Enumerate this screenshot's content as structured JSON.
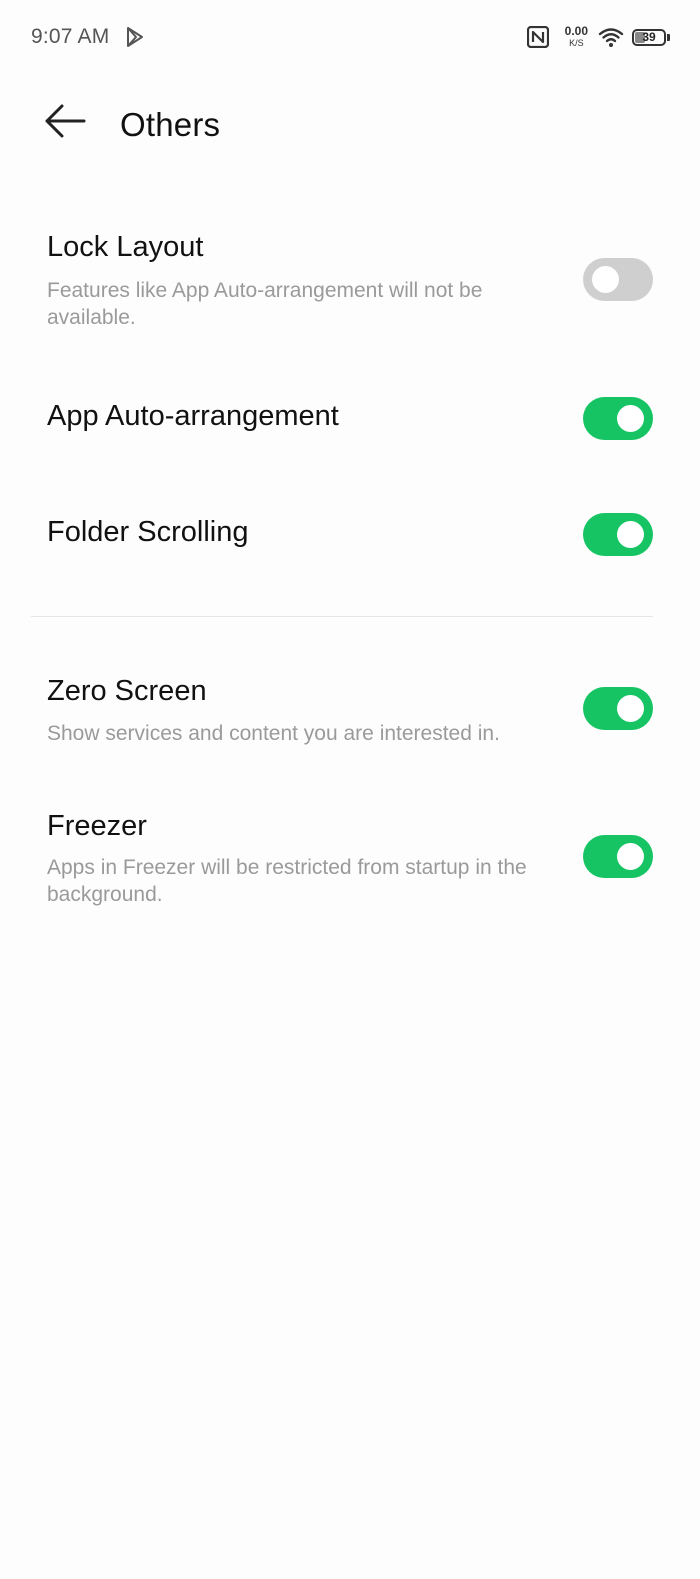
{
  "status_bar": {
    "time": "9:07 AM",
    "net_speed_value": "0.00",
    "net_speed_unit": "K/S",
    "battery_level": "39",
    "icons": [
      "play-store-icon",
      "nfc-icon",
      "wifi-icon",
      "battery-icon"
    ]
  },
  "header": {
    "title": "Others",
    "back_icon": "arrow-left-icon"
  },
  "settings": [
    {
      "title": "Lock Layout",
      "description": "Features like App Auto-arrangement will not be available.",
      "enabled": false
    },
    {
      "title": "App Auto-arrangement",
      "description": "",
      "enabled": true
    },
    {
      "title": "Folder Scrolling",
      "description": "",
      "enabled": true
    },
    {
      "title": "Zero Screen",
      "description": "Show services and content you are interested in.",
      "enabled": true
    },
    {
      "title": "Freezer",
      "description": "Apps in Freezer will be restricted from startup in the background.",
      "enabled": true
    }
  ],
  "colors": {
    "toggle_on": "#16c464",
    "toggle_off": "#cfcfcf",
    "secondary_text": "#9a9a9a",
    "background": "#fdfdfd"
  }
}
